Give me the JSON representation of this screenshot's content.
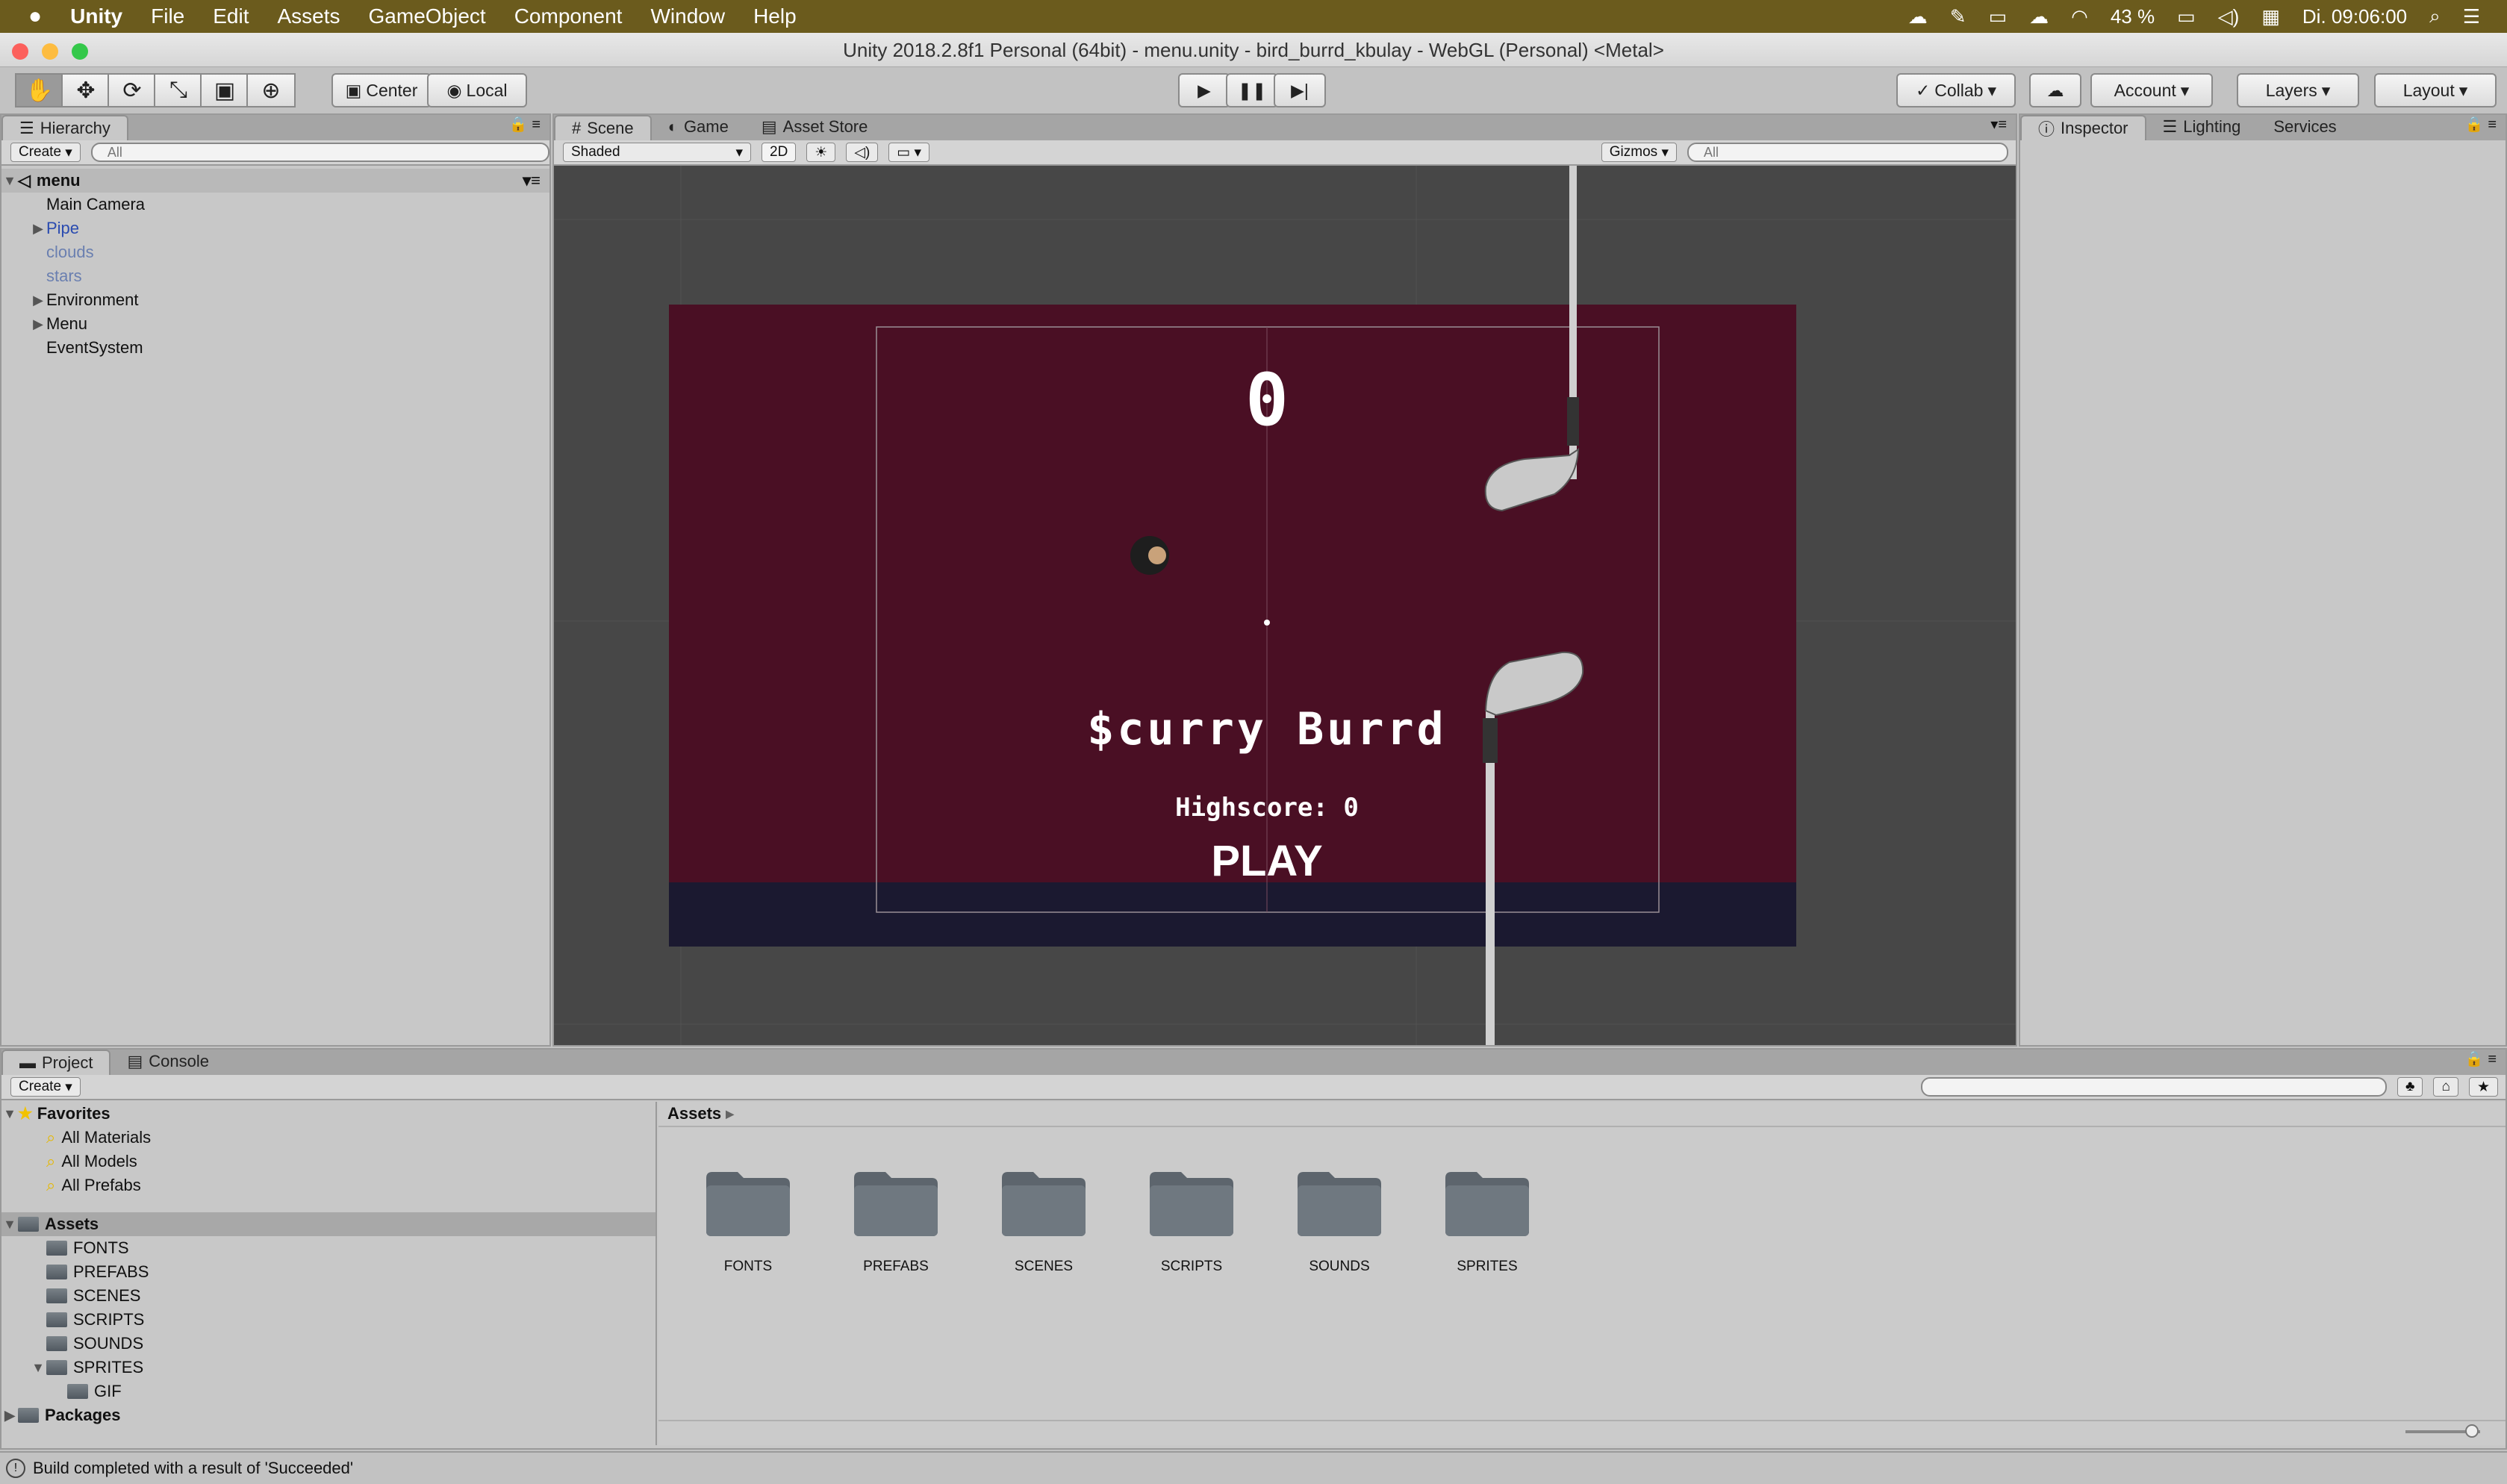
{
  "menubar": {
    "apple": "",
    "app_name": "Unity",
    "items": [
      "File",
      "Edit",
      "Assets",
      "GameObject",
      "Component",
      "Window",
      "Help"
    ],
    "battery": "43 %",
    "clock": "Di. 09:06:00"
  },
  "window": {
    "title": "Unity 2018.2.8f1 Personal (64bit) - menu.unity - bird_burrd_kbulay - WebGL (Personal) <Metal>"
  },
  "toolbar": {
    "pivot": "Center",
    "space": "Local",
    "collab": "Collab",
    "account": "Account",
    "layers": "Layers",
    "layout": "Layout"
  },
  "hierarchy": {
    "tab": "Hierarchy",
    "create": "Create",
    "search_placeholder": "All",
    "scene": "menu",
    "items": [
      {
        "label": "Main Camera"
      },
      {
        "label": "Pipe"
      },
      {
        "label": "clouds"
      },
      {
        "label": "stars"
      },
      {
        "label": "Environment"
      },
      {
        "label": "Menu"
      },
      {
        "label": "EventSystem"
      }
    ]
  },
  "scene_view": {
    "tabs": [
      "Scene",
      "Game",
      "Asset Store"
    ],
    "shading": "Shaded",
    "mode_2d": "2D",
    "gizmos": "Gizmos",
    "search_placeholder": "All",
    "game": {
      "score": "0",
      "title": "$curry Burrd",
      "highscore": "Highscore: 0",
      "play": "PLAY",
      "colors": {
        "background": "#4a0f24",
        "ground": "#1b1930",
        "viewport": "#474747"
      }
    }
  },
  "inspector": {
    "tabs": [
      "Inspector",
      "Lighting",
      "Services"
    ]
  },
  "project": {
    "tabs": [
      "Project",
      "Console"
    ],
    "create": "Create",
    "favorites": {
      "label": "Favorites",
      "items": [
        "All Materials",
        "All Models",
        "All Prefabs"
      ]
    },
    "assets_root": "Assets",
    "tree": [
      "FONTS",
      "PREFABS",
      "SCENES",
      "SCRIPTS",
      "SOUNDS",
      "SPRITES"
    ],
    "sprites_child": "GIF",
    "packages": "Packages",
    "breadcrumb": "Assets",
    "folders": [
      "FONTS",
      "PREFABS",
      "SCENES",
      "SCRIPTS",
      "SOUNDS",
      "SPRITES"
    ]
  },
  "status": {
    "message": "Build completed with a result of 'Succeeded'"
  }
}
